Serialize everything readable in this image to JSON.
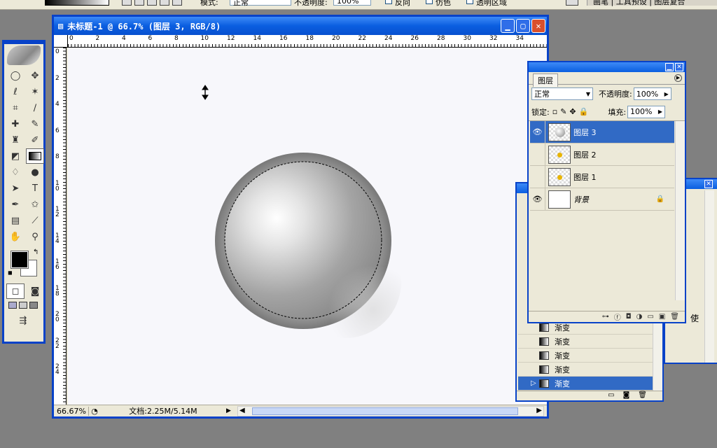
{
  "options_bar": {
    "mode_label": "模式:",
    "mode_value": "正常",
    "opacity_label": "不透明度:",
    "opacity_value": "100%",
    "reverse_label": "反向",
    "dither_label": "仿色",
    "transparency_label": "透明区域",
    "well_text": "画笔 | 工具预设 | 图层复合"
  },
  "document": {
    "title": "未标题-1 @ 66.7% (图层 3, RGB/8)",
    "ruler_top_numbers": [
      "0",
      "2",
      "4",
      "6",
      "8",
      "10",
      "12",
      "14",
      "16",
      "18",
      "20",
      "22",
      "24",
      "26",
      "28",
      "30",
      "32",
      "34"
    ],
    "ruler_left_numbers": [
      "0",
      "2",
      "4",
      "6",
      "8",
      "10",
      "12",
      "14",
      "16",
      "18",
      "20",
      "22",
      "24"
    ],
    "zoom": "66.67%",
    "doc_size": "文档:2.25M/5.14M"
  },
  "layers_panel": {
    "tab": "图层",
    "blend_mode": "正常",
    "opacity_label": "不透明度:",
    "opacity_value": "100%",
    "lock_label": "锁定:",
    "fill_label": "填充:",
    "fill_value": "100%",
    "layers": [
      {
        "name": "图层 3",
        "visible": true,
        "selected": true
      },
      {
        "name": "图层 2",
        "visible": false,
        "selected": false
      },
      {
        "name": "图层 1",
        "visible": false,
        "selected": false
      },
      {
        "name": "背景",
        "visible": true,
        "selected": false,
        "locked": true
      }
    ]
  },
  "history_panel": {
    "items": [
      {
        "label": "渐变",
        "selected": false
      },
      {
        "label": "渐变",
        "selected": false
      },
      {
        "label": "渐变",
        "selected": false
      },
      {
        "label": "渐变",
        "selected": false
      },
      {
        "label": "渐变",
        "selected": true
      }
    ],
    "side_text": "使"
  },
  "colors": {
    "foreground": "#000000",
    "background": "#ffffff",
    "title_bar": "#0842c8",
    "selection": "#316ac5"
  }
}
